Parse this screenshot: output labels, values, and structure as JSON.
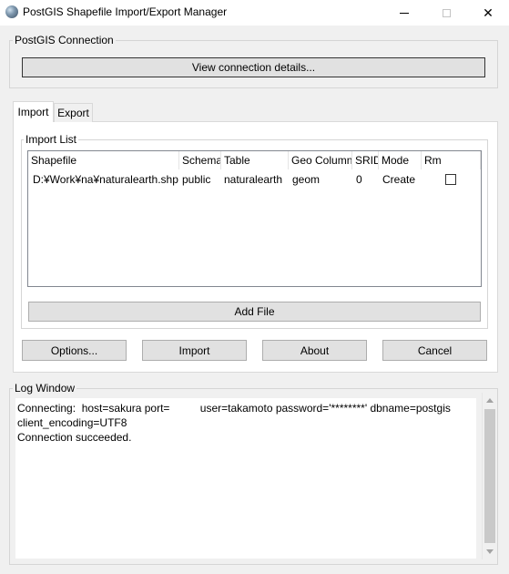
{
  "window": {
    "title": "PostGIS Shapefile Import/Export Manager",
    "close_glyph": "✕"
  },
  "connection": {
    "legend": "PostGIS Connection",
    "view_details_label": "View connection details..."
  },
  "tabs": [
    {
      "label": "Import"
    },
    {
      "label": "Export"
    }
  ],
  "import_list": {
    "legend": "Import List",
    "columns": [
      "Shapefile",
      "Schema",
      "Table",
      "Geo Column",
      "SRID",
      "Mode",
      "Rm"
    ],
    "rows": [
      {
        "shapefile": "D:¥Work¥na¥naturalearth.shp",
        "schema": "public",
        "table": "naturalearth",
        "geo_column": "geom",
        "srid": "0",
        "mode": "Create",
        "rm": false
      }
    ],
    "add_file_label": "Add File"
  },
  "actions": {
    "options_label": "Options...",
    "import_label": "Import",
    "about_label": "About",
    "cancel_label": "Cancel"
  },
  "log": {
    "legend": "Log Window",
    "text": "Connecting:  host=sakura port=          user=takamoto password='********' dbname=postgis\nclient_encoding=UTF8\nConnection succeeded."
  }
}
